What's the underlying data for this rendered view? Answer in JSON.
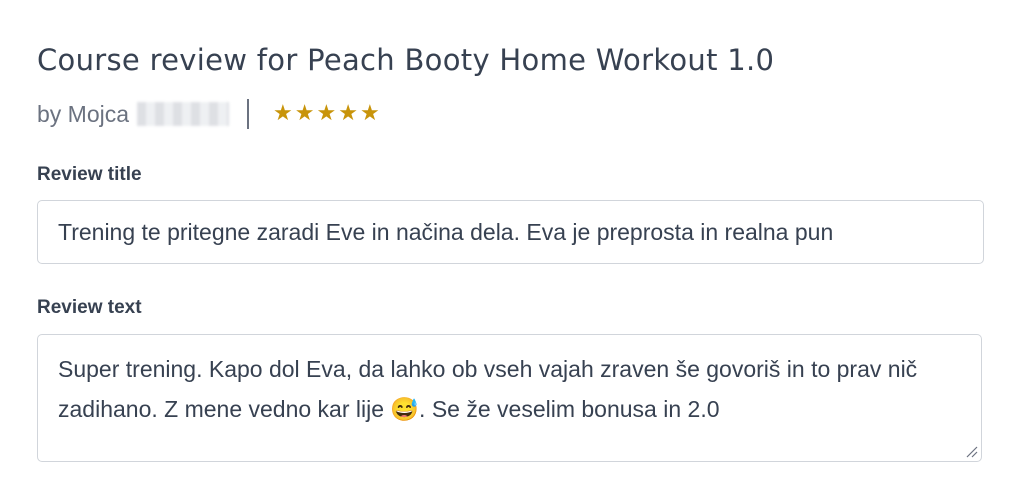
{
  "header": {
    "title": "Course review for Peach Booty Home Workout 1.0",
    "author_prefix": "by Mojca",
    "rating": 5,
    "stars": [
      "★",
      "★",
      "★",
      "★",
      "★"
    ],
    "star_color": "#c8940a"
  },
  "form": {
    "review_title_label": "Review title",
    "review_title_value": "Trening te pritegne zaradi Eve in načina dela. Eva je preprosta in realna pun",
    "review_text_label": "Review text",
    "review_text_value": "Super trening. Kapo dol Eva, da lahko ob vseh vajah zraven še govoriš in to prav nič zadihano. Z mene vedno kar lije 😅. Se že veselim bonusa in 2.0"
  }
}
